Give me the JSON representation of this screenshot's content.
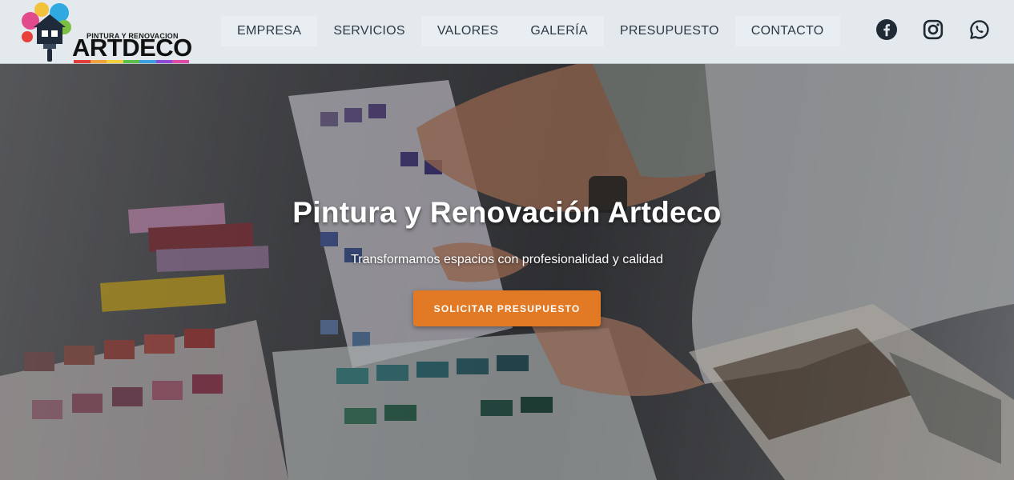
{
  "brand": {
    "tagline": "PINTURA Y RENOVACION",
    "name": "ARTDECO",
    "stripe_colors": [
      "#e23d3d",
      "#f1a23a",
      "#f4d03f",
      "#5bbf4a",
      "#3aa0e0",
      "#8e4ad6",
      "#e04aa5"
    ]
  },
  "nav": {
    "items": [
      {
        "label": "EMPRESA"
      },
      {
        "label": "SERVICIOS"
      },
      {
        "label": "VALORES"
      },
      {
        "label": "GALERÍA"
      },
      {
        "label": "PRESUPUESTO"
      },
      {
        "label": "CONTACTO"
      }
    ]
  },
  "social": {
    "icons": [
      "facebook-icon",
      "instagram-icon",
      "whatsapp-icon"
    ],
    "icon_color": "#1f2a35"
  },
  "hero": {
    "title": "Pintura y Renovación Artdeco",
    "subtitle": "Transformamos espacios con profesionalidad y calidad",
    "cta_label": "SOLICITAR PRESUPUESTO",
    "cta_color": "#e27a25"
  }
}
